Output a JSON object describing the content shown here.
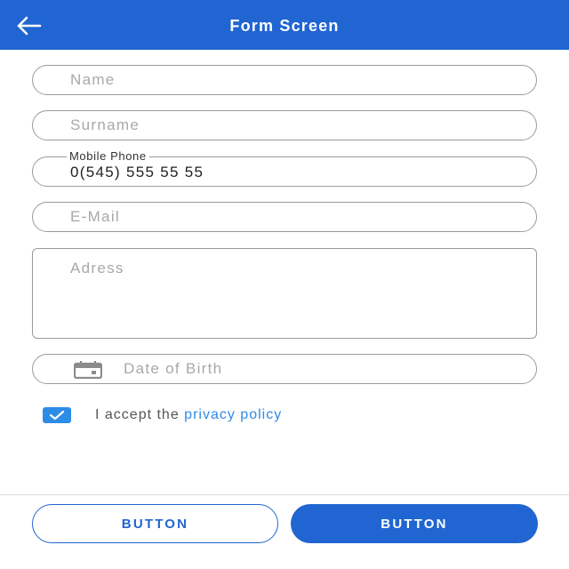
{
  "appbar": {
    "title": "Form Screen",
    "back_icon": "arrow-left-icon",
    "color": "#2065d1"
  },
  "form": {
    "name": {
      "placeholder": "Name",
      "value": ""
    },
    "surname": {
      "placeholder": "Surname",
      "value": ""
    },
    "mobile_phone": {
      "label": "Mobile Phone",
      "value": "0(545) 555 55 55"
    },
    "email": {
      "placeholder": "E-Mail",
      "value": ""
    },
    "address": {
      "placeholder": "Adress",
      "value": ""
    },
    "date_of_birth": {
      "placeholder": "Date of Birth",
      "value": "",
      "icon": "calendar-icon"
    }
  },
  "consent": {
    "checked": true,
    "text": "I accept the ",
    "link": "privacy policy",
    "checkbox_color": "#2d8ce6"
  },
  "buttons": {
    "secondary_label": "BUTTON",
    "primary_label": "BUTTON"
  }
}
